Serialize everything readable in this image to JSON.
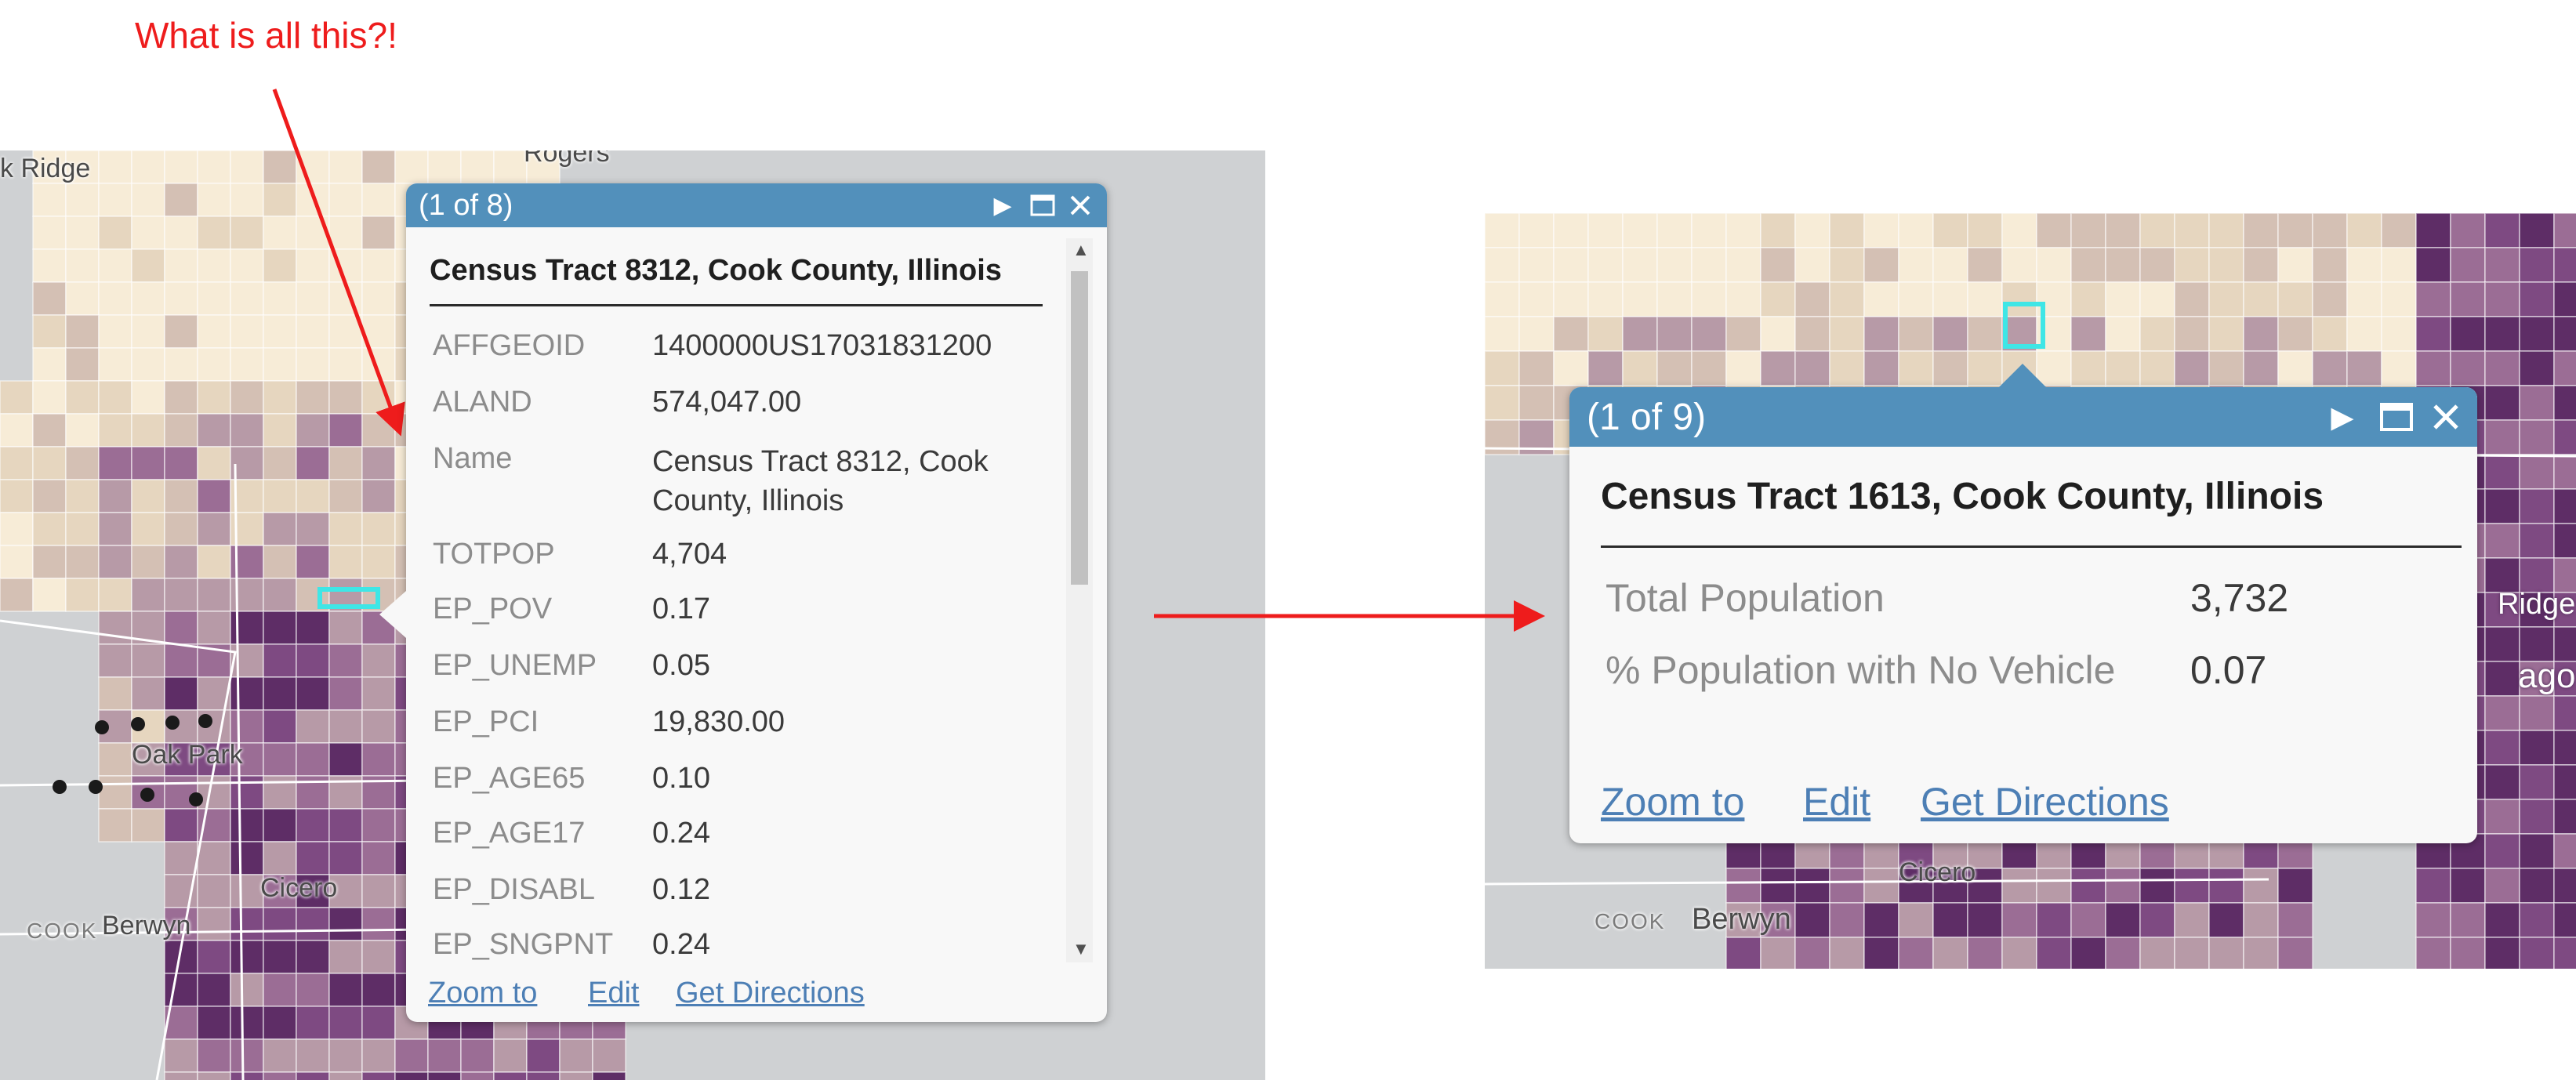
{
  "annotation": {
    "text": "What is all this?!",
    "color": "#ee1c1c"
  },
  "map_before": {
    "labels": {
      "ridge": "k Ridge",
      "rogers": "Rogers",
      "oak_park": "Oak Park",
      "cicero": "Cicero",
      "berwyn": "Berwyn",
      "cook": "COOK"
    }
  },
  "popup_before": {
    "counter": "(1 of 8)",
    "title": "Census Tract 8312, Cook County, Illinois",
    "fields": [
      {
        "name": "AFFGEOID",
        "value": "1400000US17031831200"
      },
      {
        "name": "ALAND",
        "value": "574,047.00"
      },
      {
        "name": "Name",
        "value": "Census Tract 8312, Cook County, Illinois"
      },
      {
        "name": "TOTPOP",
        "value": "4,704"
      },
      {
        "name": "EP_POV",
        "value": "0.17"
      },
      {
        "name": "EP_UNEMP",
        "value": "0.05"
      },
      {
        "name": "EP_PCI",
        "value": "19,830.00"
      },
      {
        "name": "EP_AGE65",
        "value": "0.10"
      },
      {
        "name": "EP_AGE17",
        "value": "0.24"
      },
      {
        "name": "EP_DISABL",
        "value": "0.12"
      },
      {
        "name": "EP_SNGPNT",
        "value": "0.24"
      }
    ],
    "actions": {
      "zoom": "Zoom to",
      "edit": "Edit",
      "directions": "Get Directions"
    }
  },
  "map_after": {
    "labels": {
      "cicero": "Cicero",
      "berwyn": "Berwyn",
      "cook": "COOK",
      "ridge": "Ridge",
      "chicago": "ago"
    }
  },
  "popup_after": {
    "counter": "(1 of 9)",
    "title": "Census Tract 1613, Cook County, Illinois",
    "fields": [
      {
        "name": "Total Population",
        "value": "3,732"
      },
      {
        "name": "% Population with No Vehicle",
        "value": "0.07"
      }
    ],
    "actions": {
      "zoom": "Zoom to",
      "edit": "Edit",
      "directions": "Get Directions"
    }
  },
  "colors": {
    "header": "#5290bb",
    "link": "#4d7fb5",
    "arrow": "#ee1c1c",
    "highlight": "#3fe6e6",
    "choropleth": [
      "#f7ecd7",
      "#e6d6bf",
      "#d4c0b4",
      "#b79aa7",
      "#9b6d95",
      "#7e4a82",
      "#5e2d66"
    ]
  }
}
